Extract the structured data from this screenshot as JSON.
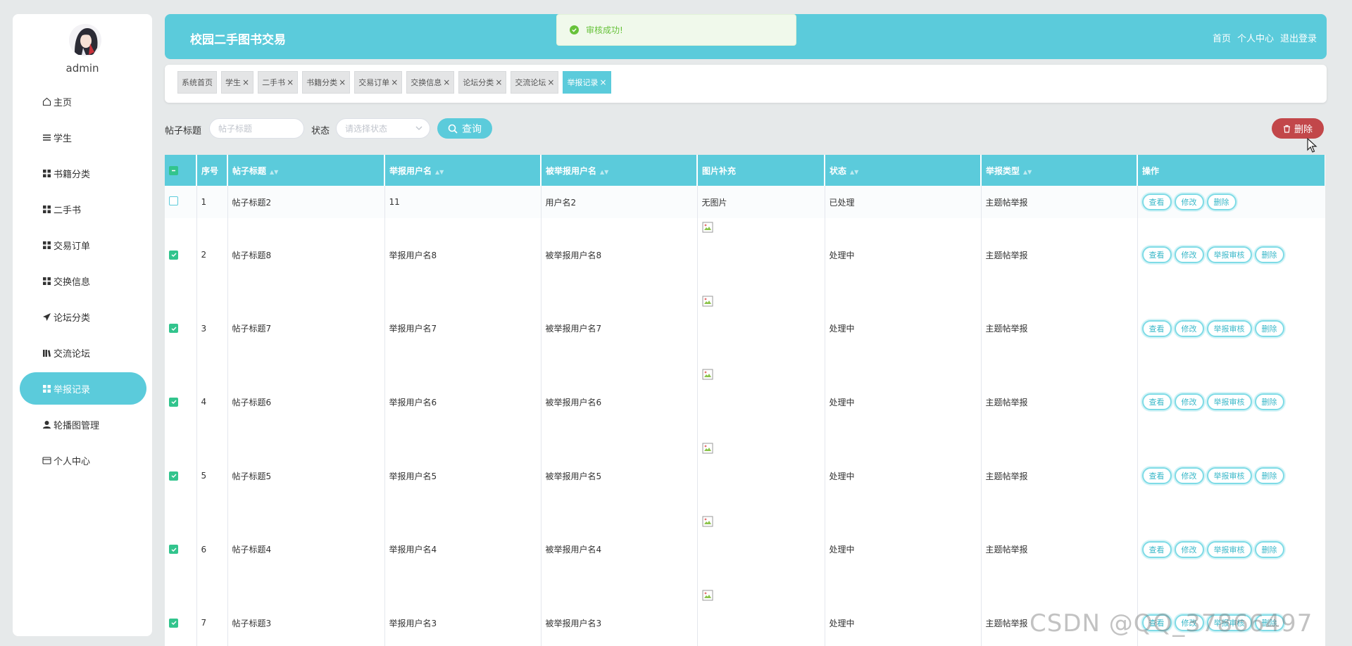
{
  "sidebar": {
    "username": "admin",
    "items": [
      {
        "label": "主页",
        "icon": "home-icon"
      },
      {
        "label": "学生",
        "icon": "list-icon"
      },
      {
        "label": "书籍分类",
        "icon": "grid-icon"
      },
      {
        "label": "二手书",
        "icon": "grid-icon"
      },
      {
        "label": "交易订单",
        "icon": "grid-icon"
      },
      {
        "label": "交换信息",
        "icon": "grid-icon"
      },
      {
        "label": "论坛分类",
        "icon": "paper-plane-icon"
      },
      {
        "label": "交流论坛",
        "icon": "library-icon"
      },
      {
        "label": "举报记录",
        "icon": "grid-icon",
        "active": true
      },
      {
        "label": "轮播图管理",
        "icon": "user-icon"
      },
      {
        "label": "个人中心",
        "icon": "card-icon"
      }
    ]
  },
  "header": {
    "title": "校园二手图书交易",
    "links": [
      "首页",
      "个人中心",
      "退出登录"
    ]
  },
  "toast": {
    "message": "审核成功!"
  },
  "tags": [
    {
      "label": "系统首页",
      "closable": false
    },
    {
      "label": "学生",
      "closable": true
    },
    {
      "label": "二手书",
      "closable": true
    },
    {
      "label": "书籍分类",
      "closable": true
    },
    {
      "label": "交易订单",
      "closable": true
    },
    {
      "label": "交换信息",
      "closable": true
    },
    {
      "label": "论坛分类",
      "closable": true
    },
    {
      "label": "交流论坛",
      "closable": true
    },
    {
      "label": "举报记录",
      "closable": true,
      "active": true
    }
  ],
  "search": {
    "title_label": "帖子标题",
    "title_placeholder": "帖子标题",
    "status_label": "状态",
    "status_placeholder": "请选择状态",
    "query_label": "查询",
    "delete_label": "删除"
  },
  "table": {
    "headers": [
      "序号",
      "帖子标题",
      "举报用户名",
      "被举报用户名",
      "图片补充",
      "状态",
      "举报类型",
      "操作"
    ],
    "rows": [
      {
        "checked": false,
        "no": "1",
        "title": "帖子标题2",
        "reporter": "11",
        "reported": "用户名2",
        "image": "无图片",
        "status": "已处理",
        "type": "主题帖举报",
        "ops": [
          "查看",
          "修改",
          "删除"
        ]
      },
      {
        "checked": true,
        "no": "2",
        "title": "帖子标题8",
        "reporter": "举报用户名8",
        "reported": "被举报用户名8",
        "image": "",
        "status": "处理中",
        "type": "主题帖举报",
        "ops": [
          "查看",
          "修改",
          "举报审核",
          "删除"
        ]
      },
      {
        "checked": true,
        "no": "3",
        "title": "帖子标题7",
        "reporter": "举报用户名7",
        "reported": "被举报用户名7",
        "image": "",
        "status": "处理中",
        "type": "主题帖举报",
        "ops": [
          "查看",
          "修改",
          "举报审核",
          "删除"
        ]
      },
      {
        "checked": true,
        "no": "4",
        "title": "帖子标题6",
        "reporter": "举报用户名6",
        "reported": "被举报用户名6",
        "image": "",
        "status": "处理中",
        "type": "主题帖举报",
        "ops": [
          "查看",
          "修改",
          "举报审核",
          "删除"
        ]
      },
      {
        "checked": true,
        "no": "5",
        "title": "帖子标题5",
        "reporter": "举报用户名5",
        "reported": "被举报用户名5",
        "image": "",
        "status": "处理中",
        "type": "主题帖举报",
        "ops": [
          "查看",
          "修改",
          "举报审核",
          "删除"
        ]
      },
      {
        "checked": true,
        "no": "6",
        "title": "帖子标题4",
        "reporter": "举报用户名4",
        "reported": "被举报用户名4",
        "image": "",
        "status": "处理中",
        "type": "主题帖举报",
        "ops": [
          "查看",
          "修改",
          "举报审核",
          "删除"
        ]
      },
      {
        "checked": true,
        "no": "7",
        "title": "帖子标题3",
        "reporter": "举报用户名3",
        "reported": "被举报用户名3",
        "image": "",
        "status": "处理中",
        "type": "主题帖举报",
        "ops": [
          "查看",
          "修改",
          "举报审核",
          "删除"
        ]
      }
    ]
  },
  "watermark": "CSDN @QQ_37866497",
  "colors": {
    "accent": "#5bcbdb",
    "danger": "#c2474a",
    "check": "#32c48d",
    "success": "#67c23a"
  }
}
